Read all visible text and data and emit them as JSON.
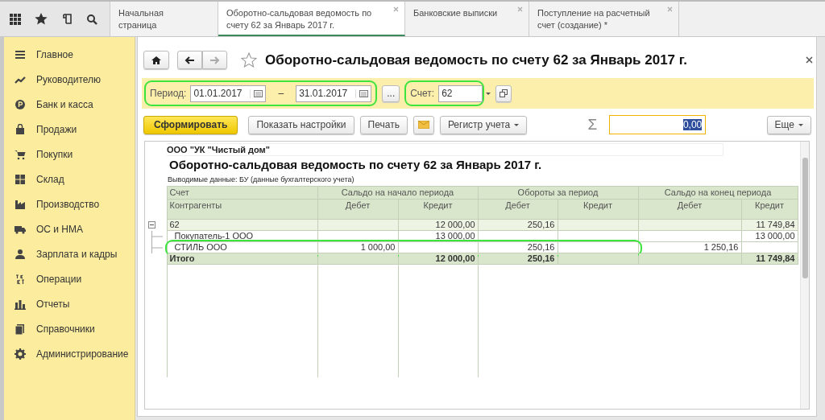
{
  "tabs": [
    {
      "label": "Начальная страница",
      "selected": false,
      "closable": false
    },
    {
      "label": "Оборотно-сальдовая ведомость по счету 62 за Январь 2017 г.",
      "selected": true,
      "closable": true
    },
    {
      "label": "Банковские выписки",
      "selected": false,
      "closable": true
    },
    {
      "label": "Поступление на расчетный счет (создание) *",
      "selected": false,
      "closable": true
    }
  ],
  "sidebar": {
    "items": [
      {
        "label": "Главное"
      },
      {
        "label": "Руководителю"
      },
      {
        "label": "Банк и касса"
      },
      {
        "label": "Продажи"
      },
      {
        "label": "Покупки"
      },
      {
        "label": "Склад"
      },
      {
        "label": "Производство"
      },
      {
        "label": "ОС и НМА"
      },
      {
        "label": "Зарплата и кадры"
      },
      {
        "label": "Операции"
      },
      {
        "label": "Отчеты"
      },
      {
        "label": "Справочники"
      },
      {
        "label": "Администрирование"
      }
    ]
  },
  "form": {
    "title": "Оборотно-сальдовая ведомость по счету 62 за Январь 2017 г.",
    "period": {
      "label": "Период:",
      "from": "01.01.2017",
      "dash": "–",
      "to": "31.01.2017",
      "highlighted": true
    },
    "more_period": "...",
    "account": {
      "label": "Счет:",
      "value": "62",
      "highlighted": true
    },
    "buttons": [
      {
        "label": "Сформировать",
        "kind": "primary"
      },
      {
        "label": "Показать настройки",
        "kind": "plain"
      },
      {
        "label": "Печать",
        "kind": "plain"
      },
      {
        "kind": "mail"
      },
      {
        "label": "Регистр учета",
        "kind": "dropdown"
      }
    ],
    "sum": {
      "symbol": "Σ",
      "value": "0,00",
      "selected": true
    },
    "more": "Еще"
  },
  "report": {
    "organization": "ООО \"УК \"Чистый дом\"",
    "title": "Оборотно-сальдовая ведомость по счету 62 за Январь 2017 г.",
    "note": "Выводимые данные:  БУ (данные бухгалтерского учета)",
    "header_groups": [
      "Счет",
      "Сальдо на начало периода",
      "Обороты за период",
      "Сальдо на конец периода"
    ],
    "header_columns": [
      "Контрагенты",
      "Дебет",
      "Кредит",
      "Дебет",
      "Кредит",
      "Дебет",
      "Кредит"
    ],
    "rows": [
      {
        "kind": "group",
        "expanded": true,
        "highlighted": false,
        "cells": [
          "62",
          "",
          "12 000,00",
          "250,16",
          "",
          "",
          "11 749,84"
        ]
      },
      {
        "kind": "item",
        "highlighted": false,
        "cells": [
          "Покупатель-1 ООО",
          "",
          "13 000,00",
          "",
          "",
          "",
          "13 000,00"
        ]
      },
      {
        "kind": "item",
        "highlighted": true,
        "cells": [
          "СТИЛЬ ООО",
          "1 000,00",
          "",
          "250,16",
          "",
          "1 250,16",
          ""
        ]
      },
      {
        "kind": "total",
        "highlighted": false,
        "cells": [
          "Итого",
          "",
          "12 000,00",
          "250,16",
          "",
          "",
          "11 749,84"
        ]
      }
    ]
  }
}
